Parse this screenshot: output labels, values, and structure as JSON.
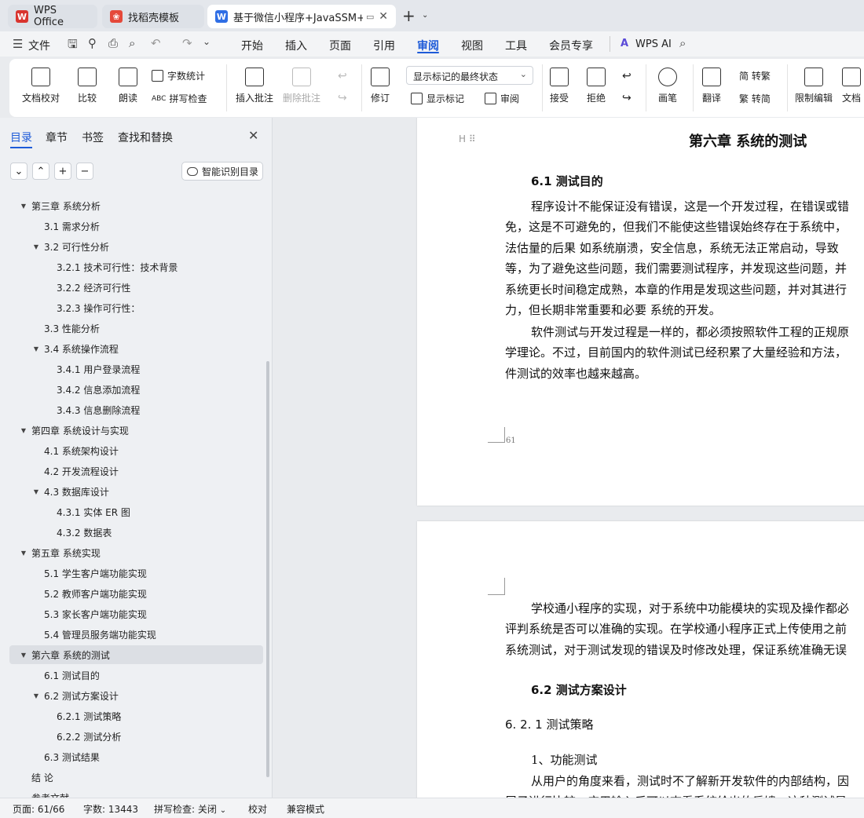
{
  "tabs": [
    {
      "label": "WPS Office",
      "icon": "wps-logo-icon",
      "color": "#d9352f"
    },
    {
      "label": "找稻壳模板",
      "icon": "docer-icon",
      "color": "#e5493a"
    },
    {
      "label": "基于微信小程序+JavaSSM+M",
      "icon": "word-doc-icon",
      "color": "#2f6ee5"
    }
  ],
  "menubar": {
    "file_label": "文件",
    "items": [
      "开始",
      "插入",
      "页面",
      "引用",
      "审阅",
      "视图",
      "工具",
      "会员专享"
    ],
    "active": "审阅",
    "wps_ai": "WPS AI"
  },
  "ribbon": {
    "doc_check": "文档校对",
    "compare": "比较",
    "read_aloud": "朗读",
    "word_count": "字数统计",
    "spell_check": "拼写检查",
    "insert_comment": "插入批注",
    "delete_comment": "删除批注",
    "track_changes": "修订",
    "markup_state": "显示标记的最终状态",
    "show_markup": "显示标记",
    "review_pane": "审阅",
    "accept": "接受",
    "reject": "拒绝",
    "pen": "画笔",
    "translate": "翻译",
    "to_traditional": "简 转繁",
    "to_simplified": "繁 转简",
    "restrict_edit": "限制编辑",
    "doc_rights": "文档"
  },
  "nav": {
    "tabs": [
      "目录",
      "章节",
      "书签",
      "查找和替换"
    ],
    "smart_toc": "智能识别目录",
    "toc": [
      {
        "label": "第三章  系统分析",
        "level": 1,
        "toggle": "▼"
      },
      {
        "label": "3.1 需求分析",
        "level": 2,
        "toggle": ""
      },
      {
        "label": "3.2 可行性分析",
        "level": 2,
        "toggle": "▼"
      },
      {
        "label": "3.2.1 技术可行性：技术背景",
        "level": 3,
        "toggle": ""
      },
      {
        "label": "3.2.2 经济可行性",
        "level": 3,
        "toggle": ""
      },
      {
        "label": "3.2.3 操作可行性：",
        "level": 3,
        "toggle": ""
      },
      {
        "label": "3.3 性能分析",
        "level": 2,
        "toggle": ""
      },
      {
        "label": "3.4 系统操作流程",
        "level": 2,
        "toggle": "▼"
      },
      {
        "label": "3.4.1 用户登录流程",
        "level": 3,
        "toggle": ""
      },
      {
        "label": "3.4.2 信息添加流程",
        "level": 3,
        "toggle": ""
      },
      {
        "label": "3.4.3 信息删除流程",
        "level": 3,
        "toggle": ""
      },
      {
        "label": "第四章  系统设计与实现",
        "level": 1,
        "toggle": "▼"
      },
      {
        "label": "4.1 系统架构设计",
        "level": 2,
        "toggle": ""
      },
      {
        "label": "4.2 开发流程设计",
        "level": 2,
        "toggle": ""
      },
      {
        "label": "4.3 数据库设计",
        "level": 2,
        "toggle": "▼"
      },
      {
        "label": "4.3.1 实体 ER 图",
        "level": 3,
        "toggle": ""
      },
      {
        "label": "4.3.2 数据表",
        "level": 3,
        "toggle": ""
      },
      {
        "label": "第五章  系统实现",
        "level": 1,
        "toggle": "▼"
      },
      {
        "label": "5.1 学生客户端功能实现",
        "level": 2,
        "toggle": ""
      },
      {
        "label": "5.2 教师客户端功能实现",
        "level": 2,
        "toggle": ""
      },
      {
        "label": "5.3 家长客户端功能实现",
        "level": 2,
        "toggle": ""
      },
      {
        "label": "5.4  管理员服务端功能实现",
        "level": 2,
        "toggle": ""
      },
      {
        "label": "第六章    系统的测试",
        "level": 1,
        "toggle": "▼",
        "selected": true
      },
      {
        "label": "6.1  测试目的",
        "level": 2,
        "toggle": ""
      },
      {
        "label": "6.2  测试方案设计",
        "level": 2,
        "toggle": "▼"
      },
      {
        "label": "6.2.1  测试策略",
        "level": 3,
        "toggle": ""
      },
      {
        "label": "6.2.2  测试分析",
        "level": 3,
        "toggle": ""
      },
      {
        "label": "6.3  测试结果",
        "level": 2,
        "toggle": ""
      },
      {
        "label": "结    论",
        "level": 1,
        "toggle": ""
      },
      {
        "label": "参考文献",
        "level": 1,
        "toggle": ""
      }
    ]
  },
  "doc": {
    "heading_marker": "H",
    "chapter_title": "第六章    系统的测试",
    "s61_title": "6.1  测试目的",
    "p1": [
      "程序设计不能保证没有错误，这是一个开发过程，在错误或错",
      "免，这是不可避免的，但我们不能使这些错误始终存在于系统中，",
      "法估量的后果 如系统崩溃，安全信息，系统无法正常启动，导致",
      "等，为了避免这些问题，我们需要测试程序，并发现这些问题，并",
      "系统更长时间稳定成熟，本章的作用是发现这些问题，并对其进行",
      "力，但长期非常重要和必要  系统的开发。"
    ],
    "p2": [
      "软件测试与开发过程是一样的，都必须按照软件工程的正规原",
      "学理论。不过，目前国内的软件测试已经积累了大量经验和方法，",
      "件测试的效率也越来越高。"
    ],
    "page_number": "61",
    "p3": [
      "学校通小程序的实现，对于系统中功能模块的实现及操作都必",
      "评判系统是否可以准确的实现。在学校通小程序正式上传使用之前",
      "系统测试，对于测试发现的错误及时修改处理，保证系统准确无误"
    ],
    "s62_title": "6.2  测试方案设计",
    "s621_title": "6. 2. 1  测试策略",
    "item1": "1、功能测试",
    "p4": [
      "从用户的角度来看，测试时不了解新开发软件的内部结构，因",
      "层子进行比较，应用输入后可以查看系统给出的反馈，这种测试是"
    ]
  },
  "status": {
    "page": "页面: 61/66",
    "words": "字数: 13443",
    "spell": "拼写检查: 关闭",
    "proof": "校对",
    "compat": "兼容模式"
  }
}
